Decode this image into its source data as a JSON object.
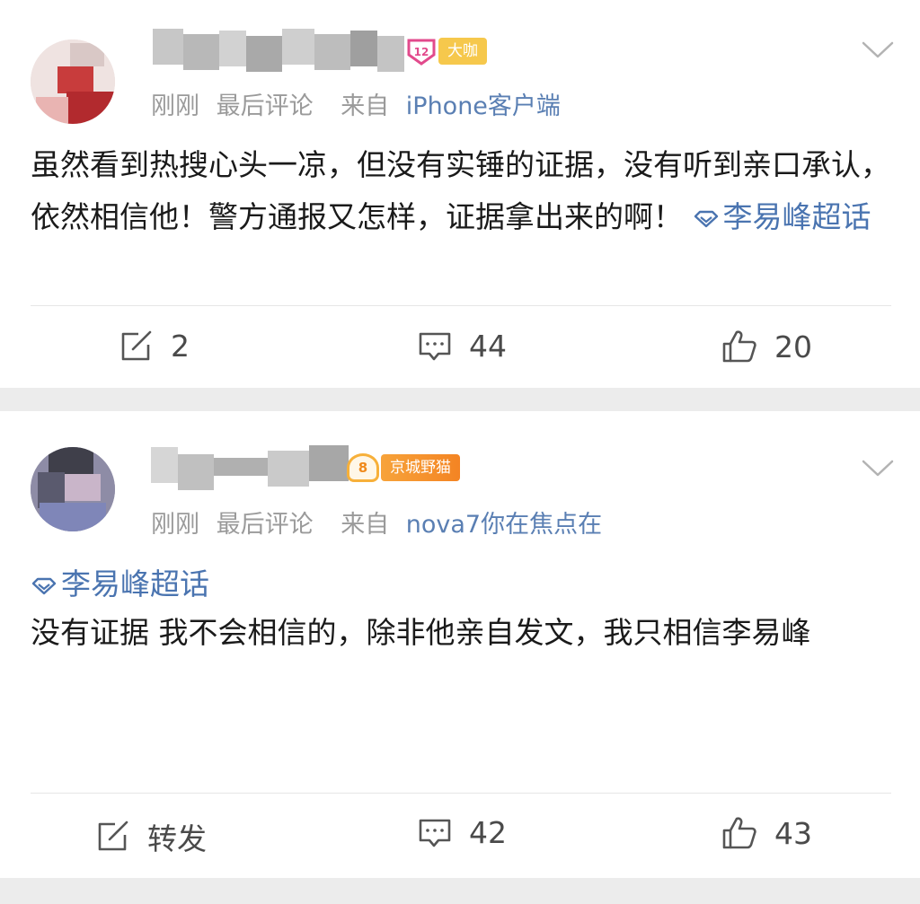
{
  "posts": [
    {
      "user_badge": {
        "level": "12",
        "tag": "大咖"
      },
      "meta": {
        "time": "刚刚",
        "action": "最后评论",
        "from_label": "来自",
        "source": "iPhone客户端"
      },
      "content_text": "虽然看到热搜心头一凉，但没有实锤的证据，没有听到亲口承认，依然相信他！警方通报又怎样，证据拿出来的啊！",
      "topic": "李易峰超话",
      "actions": {
        "repost": "2",
        "comments": "44",
        "likes": "20"
      }
    },
    {
      "user_badge": {
        "level": "8",
        "tag": "京城野猫"
      },
      "meta": {
        "time": "刚刚",
        "action": "最后评论",
        "from_label": "来自",
        "source": "nova7你在焦点在"
      },
      "topic": "李易峰超话",
      "content_text": "没有证据 我不会相信的，除非他亲自发文，我只相信李易峰",
      "actions": {
        "repost": "转发",
        "comments": "42",
        "likes": "43"
      }
    }
  ],
  "colors": {
    "link": "#5a7fb3",
    "meta": "#9a9a9a",
    "separator": "#ececec"
  },
  "icons": [
    "chevron-down-icon",
    "repost-icon",
    "comment-icon",
    "like-icon",
    "supertopic-icon"
  ]
}
